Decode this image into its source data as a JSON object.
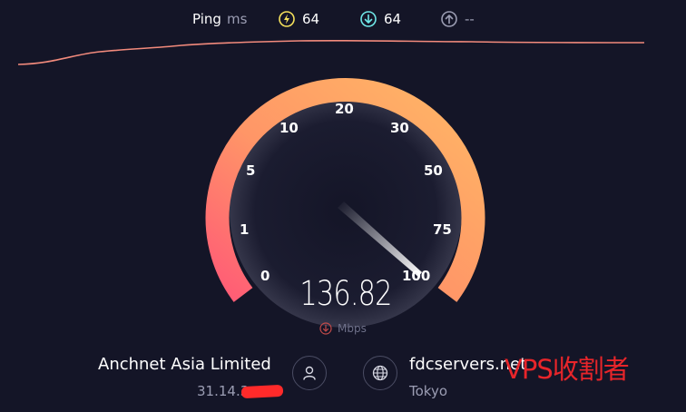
{
  "ping": {
    "label": "Ping",
    "unit": "ms",
    "jitter": {
      "icon": "lightning-icon",
      "value": "64",
      "color": "#f6e15c"
    },
    "download": {
      "icon": "arrow-down-circle-icon",
      "value": "64",
      "color": "#6fe7e8"
    },
    "upload": {
      "icon": "arrow-up-circle-icon",
      "value": "--",
      "color": "#9b9db3"
    }
  },
  "gauge": {
    "tick_labels": [
      "0",
      "1",
      "5",
      "10",
      "20",
      "30",
      "50",
      "75",
      "100"
    ],
    "current_value": "136.82",
    "unit": "Mbps",
    "unit_icon": "arrow-down-circle-icon",
    "arc_colors": {
      "start": "#ff5a76",
      "end": "#ffb765"
    },
    "needle_color": "#ffffff"
  },
  "line_graph": {
    "color": "#f28a7c"
  },
  "provider": {
    "name": "Anchnet Asia Limited",
    "ip": "31.14.3",
    "icon": "user-icon"
  },
  "server": {
    "name": "fdcservers.net",
    "location": "Tokyo",
    "icon": "globe-icon"
  },
  "watermark": {
    "text": "VPS收割者",
    "color": "#e8252a"
  }
}
